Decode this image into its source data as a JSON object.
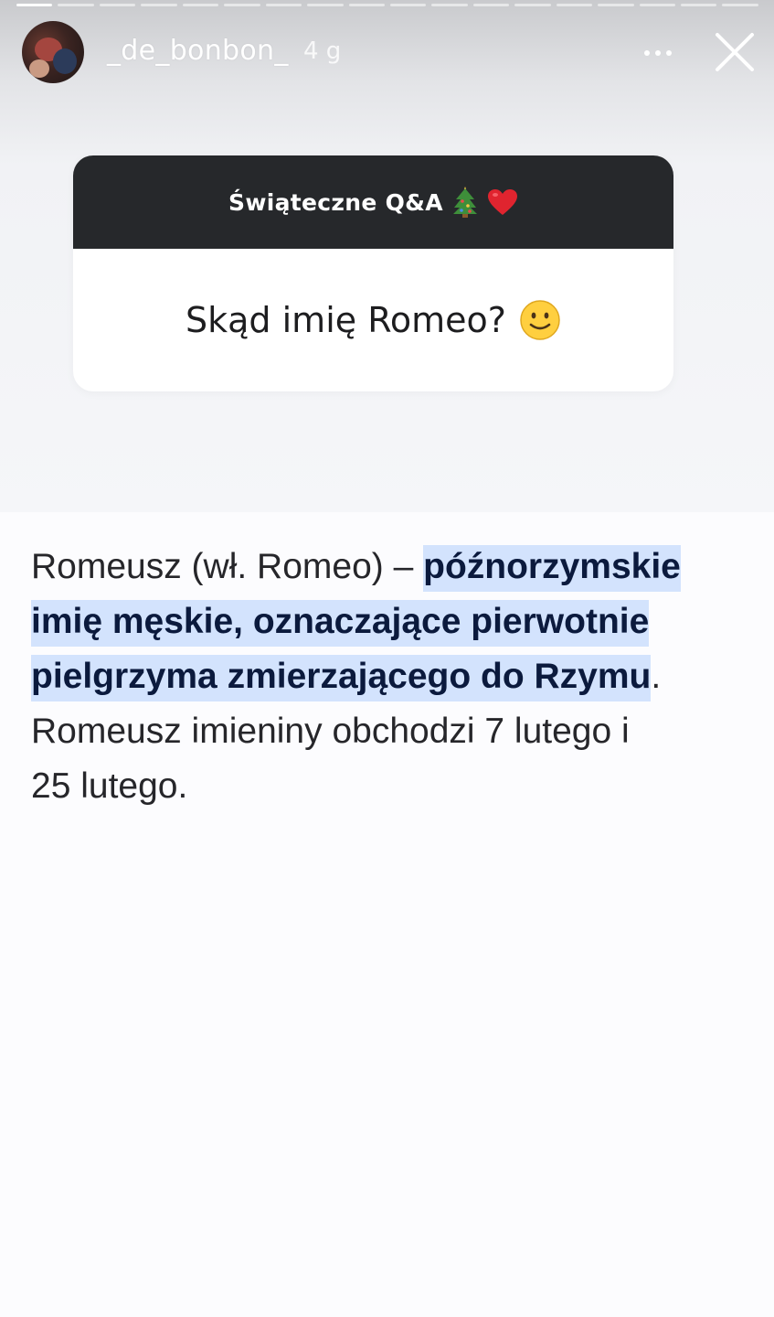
{
  "story": {
    "progress_segments": 18,
    "active_segment": 1
  },
  "header": {
    "username": "_de_bonbon_",
    "time_ago": "4 g",
    "more_icon": "ellipsis-icon",
    "close_icon": "close-icon"
  },
  "qa_card": {
    "title": "Świąteczne Q&A",
    "title_emojis": [
      "christmas-tree-icon",
      "red-heart-icon"
    ],
    "question": "Skąd imię Romeo?",
    "question_emoji": "smiling-face-icon",
    "header_color": "#26282b"
  },
  "answer": {
    "intro": "Romeusz (wł. Romeo) – ",
    "highlight_1": "późnorzymskie",
    "highlight_2": "imię męskie, oznaczające pierwotnie",
    "highlight_3": "pielgrzyma zmierzającego do Rzymu",
    "after_highlight": ".",
    "line_4": "Romeusz imieniny obchodzi 7 lutego i",
    "line_5": "25 lutego.",
    "highlight_color": "#d3e3fd"
  }
}
